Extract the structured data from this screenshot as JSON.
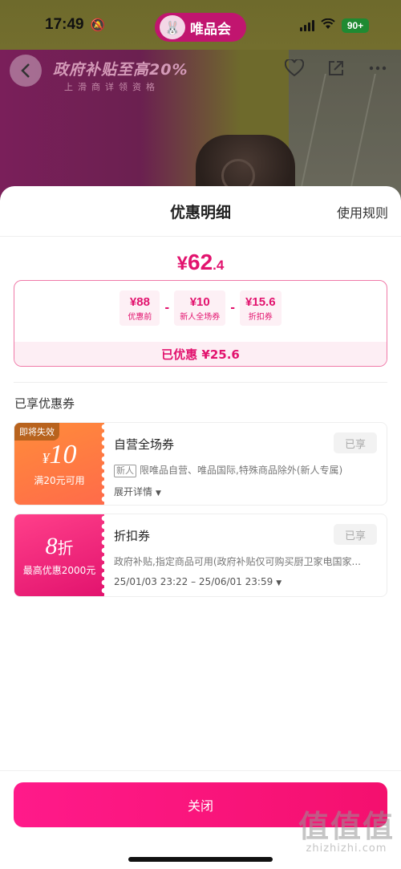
{
  "status_bar": {
    "time": "17:49",
    "battery": "90+"
  },
  "app_pill": {
    "label": "唯品会"
  },
  "banner": {
    "main": "政府补贴至高20%",
    "sub": "上滑商详领资格"
  },
  "sheet": {
    "title": "优惠明细",
    "rules_link": "使用规则",
    "final_price": {
      "currency": "¥",
      "integer": "62",
      "decimal": ".4"
    },
    "breakdown": [
      {
        "value": "¥88",
        "label": "优惠前"
      },
      {
        "value": "¥10",
        "label": "新人全场券"
      },
      {
        "value": "¥15.6",
        "label": "折扣券"
      }
    ],
    "operator": "-",
    "saved": "已优惠 ¥25.6",
    "section_label": "已享优惠券"
  },
  "coupons": [
    {
      "expire_tag": "即将失效",
      "currency": "¥",
      "amount": "10",
      "condition": "满20元可用",
      "title": "自营全场券",
      "badge": "已享",
      "new_tag": "新人",
      "desc": "限唯品自营、唯品国际,特殊商品除外(新人专属)",
      "extra": "展开详情"
    },
    {
      "amount": "8",
      "unit": "折",
      "condition": "最高优惠2000元",
      "title": "折扣券",
      "badge": "已享",
      "desc": "政府补贴,指定商品可用(政府补贴仅可购买厨卫家电国家...",
      "extra": "25/01/03 23:22 – 25/06/01 23:59"
    }
  ],
  "close_button": "关闭",
  "watermark": {
    "big": "值值值",
    "small": "zhizhizhi.com"
  }
}
